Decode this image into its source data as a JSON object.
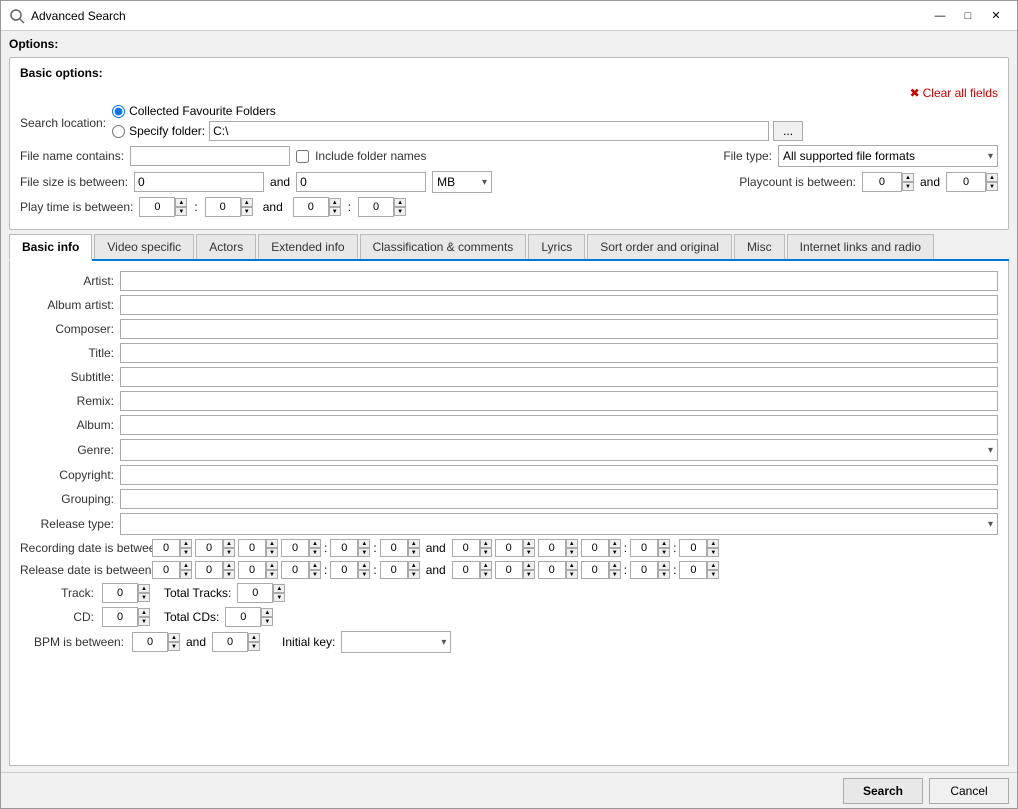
{
  "window": {
    "title": "Advanced Search",
    "controls": {
      "minimize": "—",
      "maximize": "□",
      "close": "✕"
    }
  },
  "options_label": "Options:",
  "basic_options_label": "Basic options:",
  "clear_all_label": "Clear all fields",
  "search_location_label": "Search location:",
  "radio_collected": "Collected Favourite Folders",
  "radio_specify": "Specify folder:",
  "folder_value": "C:\\",
  "browse_label": "...",
  "file_name_label": "File name contains:",
  "include_folders_label": "Include folder names",
  "file_type_label": "File type:",
  "file_type_value": "All supported file formats",
  "file_size_label": "File size is between:",
  "file_size_from": "0",
  "file_size_and": "and",
  "file_size_to": "0",
  "file_size_unit": "MB",
  "playcount_label": "Playcount is between:",
  "playcount_from": "0",
  "playcount_and": "and",
  "playcount_to": "0",
  "playtime_label": "Play time is between:",
  "playtime_h1": "0",
  "playtime_m1": "0",
  "playtime_h2": "0",
  "playtime_m2": "0",
  "tabs": [
    {
      "id": "basic_info",
      "label": "Basic info",
      "active": true
    },
    {
      "id": "video_specific",
      "label": "Video specific",
      "active": false
    },
    {
      "id": "actors",
      "label": "Actors",
      "active": false
    },
    {
      "id": "extended_info",
      "label": "Extended info",
      "active": false
    },
    {
      "id": "classification",
      "label": "Classification & comments",
      "active": false
    },
    {
      "id": "lyrics",
      "label": "Lyrics",
      "active": false
    },
    {
      "id": "sort_order",
      "label": "Sort order and original",
      "active": false
    },
    {
      "id": "misc",
      "label": "Misc",
      "active": false
    },
    {
      "id": "internet",
      "label": "Internet links and radio",
      "active": false
    }
  ],
  "fields": [
    {
      "label": "Artist:",
      "type": "text"
    },
    {
      "label": "Album artist:",
      "type": "text"
    },
    {
      "label": "Composer:",
      "type": "text"
    },
    {
      "label": "Title:",
      "type": "text"
    },
    {
      "label": "Subtitle:",
      "type": "text"
    },
    {
      "label": "Remix:",
      "type": "text"
    },
    {
      "label": "Album:",
      "type": "text"
    },
    {
      "label": "Genre:",
      "type": "select"
    },
    {
      "label": "Copyright:",
      "type": "text"
    },
    {
      "label": "Grouping:",
      "type": "text"
    },
    {
      "label": "Release type:",
      "type": "select"
    }
  ],
  "recording_date_label": "Recording date is between:",
  "release_date_label": "Release date is between:",
  "track_label": "Track:",
  "track_value": "0",
  "total_tracks_label": "Total Tracks:",
  "total_tracks_value": "0",
  "cd_label": "CD:",
  "cd_value": "0",
  "total_cds_label": "Total CDs:",
  "total_cds_value": "0",
  "bpm_label": "BPM is between:",
  "bpm_from": "0",
  "bpm_and": "and",
  "bpm_to": "0",
  "initial_key_label": "Initial key:",
  "search_btn": "Search",
  "cancel_btn": "Cancel",
  "date_zero": "0"
}
